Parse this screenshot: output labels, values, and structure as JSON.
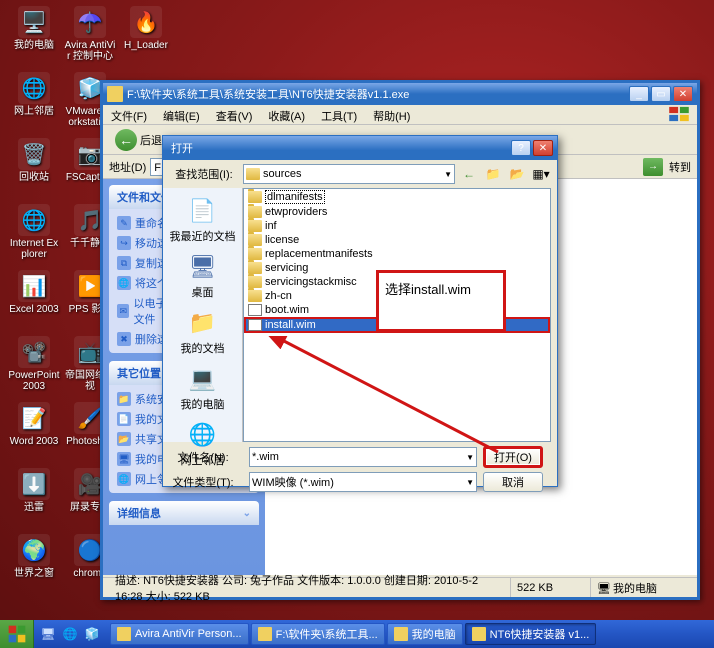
{
  "desktop_icons": [
    {
      "label": "我的电脑",
      "row": 0,
      "col": 0,
      "glyph": "🖥️"
    },
    {
      "label": "Avira AntiVir 控制中心",
      "row": 0,
      "col": 1,
      "glyph": "☂️"
    },
    {
      "label": "H_Loader",
      "row": 0,
      "col": 2,
      "glyph": "🔥"
    },
    {
      "label": "网上邻居",
      "row": 1,
      "col": 0,
      "glyph": "🌐"
    },
    {
      "label": "VMware Workstation",
      "row": 1,
      "col": 1,
      "glyph": "🧊"
    },
    {
      "label": "回收站",
      "row": 2,
      "col": 0,
      "glyph": "🗑️"
    },
    {
      "label": "FSCapture",
      "row": 2,
      "col": 1,
      "glyph": "📷"
    },
    {
      "label": "Internet Explorer",
      "row": 3,
      "col": 0,
      "glyph": "🌐"
    },
    {
      "label": "千千静听",
      "row": 3,
      "col": 1,
      "glyph": "🎵"
    },
    {
      "label": "Excel 2003",
      "row": 4,
      "col": 0,
      "glyph": "📊"
    },
    {
      "label": "PPS 影音",
      "row": 4,
      "col": 1,
      "glyph": "▶️"
    },
    {
      "label": "PowerPoint 2003",
      "row": 5,
      "col": 0,
      "glyph": "📽️"
    },
    {
      "label": "帝国网络电视",
      "row": 5,
      "col": 1,
      "glyph": "📺"
    },
    {
      "label": "Word 2003",
      "row": 6,
      "col": 0,
      "glyph": "📝"
    },
    {
      "label": "Photoshop",
      "row": 6,
      "col": 1,
      "glyph": "🖌️"
    },
    {
      "label": "迅雷",
      "row": 7,
      "col": 0,
      "glyph": "⬇️"
    },
    {
      "label": "屏录专家",
      "row": 7,
      "col": 1,
      "glyph": "🎥"
    },
    {
      "label": "世界之窗",
      "row": 8,
      "col": 0,
      "glyph": "🌍"
    },
    {
      "label": "chrome",
      "row": 8,
      "col": 1,
      "glyph": "🔵"
    }
  ],
  "explorer": {
    "title": "F:\\软件夹\\系统工具\\系统安装工具\\NT6快捷安装器v1.1.exe",
    "menu": [
      "文件(F)",
      "编辑(E)",
      "查看(V)",
      "收藏(A)",
      "工具(T)",
      "帮助(H)"
    ],
    "back": "后退",
    "addr_label": "地址(D)",
    "addr_value": "F",
    "go": "转到",
    "panels": [
      {
        "title": "文件和文件夹任务",
        "items": [
          {
            "label": "重命名这个文件",
            "glyph": "✎"
          },
          {
            "label": "移动这个文件",
            "glyph": "↪"
          },
          {
            "label": "复制这个文件",
            "glyph": "⧉"
          },
          {
            "label": "将这个文件发布到 Web",
            "glyph": "🌐"
          },
          {
            "label": "以电子邮件形式发送此文件",
            "glyph": "✉"
          },
          {
            "label": "删除这个文件",
            "glyph": "✖"
          }
        ]
      },
      {
        "title": "其它位置",
        "items": [
          {
            "label": "系统安装工具",
            "glyph": "📁"
          },
          {
            "label": "我的文档",
            "glyph": "📄"
          },
          {
            "label": "共享文档",
            "glyph": "📂"
          },
          {
            "label": "我的电脑",
            "glyph": "🖥"
          },
          {
            "label": "网上邻居",
            "glyph": "🌐"
          }
        ]
      },
      {
        "title": "详细信息",
        "items": []
      }
    ],
    "status": {
      "desc": "描述: NT6快捷安装器 公司: 兔子作品 文件版本: 1.0.0.0 创建日期: 2010-5-2 16:28 大小: 522 KB",
      "size": "522 KB",
      "location": "我的电脑"
    }
  },
  "dialog": {
    "title": "打开",
    "lookin_label": "查找范围(I):",
    "lookin_value": "sources",
    "places": [
      {
        "label": "我最近的文档",
        "glyph": "📄"
      },
      {
        "label": "桌面",
        "glyph": "🖥"
      },
      {
        "label": "我的文档",
        "glyph": "📁"
      },
      {
        "label": "我的电脑",
        "glyph": "💻"
      },
      {
        "label": "网上邻居",
        "glyph": "🌐"
      }
    ],
    "files": [
      {
        "name": "dlmanifests",
        "type": "folder",
        "dotted": true
      },
      {
        "name": "etwproviders",
        "type": "folder"
      },
      {
        "name": "inf",
        "type": "folder"
      },
      {
        "name": "license",
        "type": "folder"
      },
      {
        "name": "replacementmanifests",
        "type": "folder"
      },
      {
        "name": "servicing",
        "type": "folder"
      },
      {
        "name": "servicingstackmisc",
        "type": "folder"
      },
      {
        "name": "zh-cn",
        "type": "folder"
      },
      {
        "name": "boot.wim",
        "type": "file"
      },
      {
        "name": "install.wim",
        "type": "file",
        "selected": true
      }
    ],
    "filename_label": "文件名(N):",
    "filename_value": "*.wim",
    "filetype_label": "文件类型(T):",
    "filetype_value": "WIM映像 (*.wim)",
    "open_btn": "打开(O)",
    "cancel_btn": "取消"
  },
  "annotation": "选择install.wim",
  "taskbar": {
    "tasks": [
      {
        "label": "Avira AntiVir Person...",
        "active": false
      },
      {
        "label": "F:\\软件夹\\系统工具...",
        "active": false
      },
      {
        "label": "我的电脑",
        "active": false
      },
      {
        "label": "NT6快捷安装器  v1...",
        "active": true
      }
    ]
  }
}
